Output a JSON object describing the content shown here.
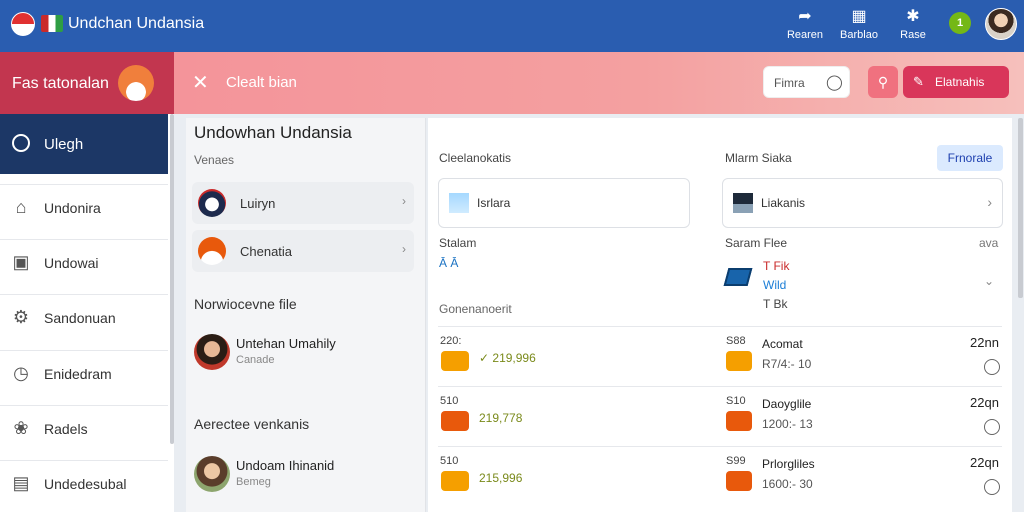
{
  "topbar": {
    "title": "Undchan Undansia",
    "actions": [
      {
        "label": "Rearen",
        "icon": "share-icon"
      },
      {
        "label": "Barblao",
        "icon": "book-icon"
      },
      {
        "label": "Rase",
        "icon": "settings-icon"
      }
    ],
    "badge": "1"
  },
  "sidebar": {
    "header": "Fas tatonalan",
    "active": {
      "label": "Ulegh",
      "icon": "circle-icon"
    },
    "items": [
      {
        "label": "Undonira",
        "icon": "home-icon"
      },
      {
        "label": "Undowai",
        "icon": "window-icon"
      },
      {
        "label": "Sandonuan",
        "icon": "gear-icon"
      },
      {
        "label": "Enidedram",
        "icon": "clock-icon"
      },
      {
        "label": "Radels",
        "icon": "cluster-icon"
      },
      {
        "label": "Undedesubal",
        "icon": "calendar-icon"
      }
    ]
  },
  "header": {
    "title": "Clealt bian",
    "search_label": "Fimra",
    "primary_button": "Elatnahis"
  },
  "left_panel": {
    "title": "Undowhan Undansia",
    "subtitle": "Venaes",
    "rows": [
      {
        "label": "Luiryn"
      },
      {
        "label": "Chenatia"
      }
    ],
    "section1": "Norwiocevne file",
    "person1": {
      "name": "Untehan Umahily",
      "status": "Canade"
    },
    "section2": "Aerectee venkanis",
    "person2": {
      "name": "Undoam Ihinanid",
      "status": "Bemeg"
    }
  },
  "main": {
    "col1_label": "Cleelanokatis",
    "col2_label": "Mlarm Siaka",
    "badge": "Frnorale",
    "card1": "Isrlara",
    "card2": "Liakanis",
    "status_label": "Stalam",
    "status_value": "Ā Ā",
    "file_label": "Saram Flee",
    "file_meta": "ava",
    "file_lines": [
      "T Fik",
      "Wild",
      "T Bk"
    ],
    "section": "Gonenanoerit",
    "rows": [
      {
        "left_val": "220:",
        "amount": "✓ 219,996",
        "right_val": "S88",
        "title": "Acomat",
        "sub": "R7/4:- 10",
        "time": "22nn"
      },
      {
        "left_val": "510",
        "amount": "219,778",
        "right_val": "S10",
        "title": "Daoyglile",
        "sub": "1200:- 13",
        "time": "22qn"
      },
      {
        "left_val": "510",
        "amount": "215,996",
        "right_val": "S99",
        "title": "Prlorgliles",
        "sub": "1600:- 30",
        "time": "22qn"
      }
    ]
  },
  "colors": {
    "topbar": "#2a5db0",
    "sidebar_header": "#c2364f",
    "sidebar_active": "#1c3766",
    "accent": "#d9365a"
  }
}
